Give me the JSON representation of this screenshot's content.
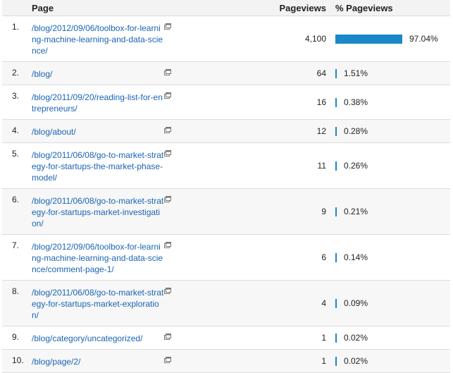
{
  "header": {
    "page": "Page",
    "pageviews": "Pageviews",
    "pct_pageviews": "% Pageviews"
  },
  "colors": {
    "link": "#1a64b4",
    "bar": "#1a87c9",
    "alt_row": "#f7f7f7"
  },
  "rows": [
    {
      "num": "1.",
      "page": "/blog/2012/09/06/toolbox-for-learning-machine-learning-and-data-science/",
      "pageviews": "4,100",
      "pct": "97.04%",
      "fraction": 0.9704
    },
    {
      "num": "2.",
      "page": "/blog/",
      "pageviews": "64",
      "pct": "1.51%",
      "fraction": 0.0151
    },
    {
      "num": "3.",
      "page": "/blog/2011/09/20/reading-list-for-entrepreneurs/",
      "pageviews": "16",
      "pct": "0.38%",
      "fraction": 0.0038
    },
    {
      "num": "4.",
      "page": "/blog/about/",
      "pageviews": "12",
      "pct": "0.28%",
      "fraction": 0.0028
    },
    {
      "num": "5.",
      "page": "/blog/2011/06/08/go-to-market-strategy-for-startups-the-market-phase-model/",
      "pageviews": "11",
      "pct": "0.26%",
      "fraction": 0.0026
    },
    {
      "num": "6.",
      "page": "/blog/2011/06/08/go-to-market-strategy-for-startups-market-investigation/",
      "pageviews": "9",
      "pct": "0.21%",
      "fraction": 0.0021
    },
    {
      "num": "7.",
      "page": "/blog/2012/09/06/toolbox-for-learning-machine-learning-and-data-science/comment-page-1/",
      "pageviews": "6",
      "pct": "0.14%",
      "fraction": 0.0014
    },
    {
      "num": "8.",
      "page": "/blog/2011/06/08/go-to-market-strategy-for-startups-market-exploration/",
      "pageviews": "4",
      "pct": "0.09%",
      "fraction": 0.0009
    },
    {
      "num": "9.",
      "page": "/blog/category/uncategorized/",
      "pageviews": "1",
      "pct": "0.02%",
      "fraction": 0.0002
    },
    {
      "num": "10.",
      "page": "/blog/page/2/",
      "pageviews": "1",
      "pct": "0.02%",
      "fraction": 0.0002
    }
  ]
}
